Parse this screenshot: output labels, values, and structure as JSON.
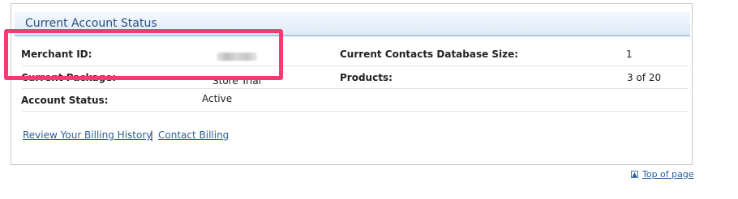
{
  "panel": {
    "title": "Current Account Status"
  },
  "rows": [
    {
      "left_label": "Merchant ID:",
      "left_value": "",
      "right_label": "Current Contacts Database Size:",
      "right_value": "1"
    },
    {
      "left_label": "Current Package:",
      "left_value": "Store Trial",
      "right_label": "Products:",
      "right_value": "3 of 20"
    },
    {
      "left_label": "Account Status:",
      "left_value": "Active",
      "right_label": "",
      "right_value": ""
    }
  ],
  "links": {
    "billing_history": "Review Your Billing History",
    "separator": "|",
    "contact_billing": "Contact Billing"
  },
  "footer": {
    "top_of_page": "Top of page",
    "top_icon": "up-arrow-box-icon"
  },
  "colors": {
    "header_text": "#2a4f82",
    "link": "#2a5d9e",
    "highlight_border": "#f13b73"
  }
}
